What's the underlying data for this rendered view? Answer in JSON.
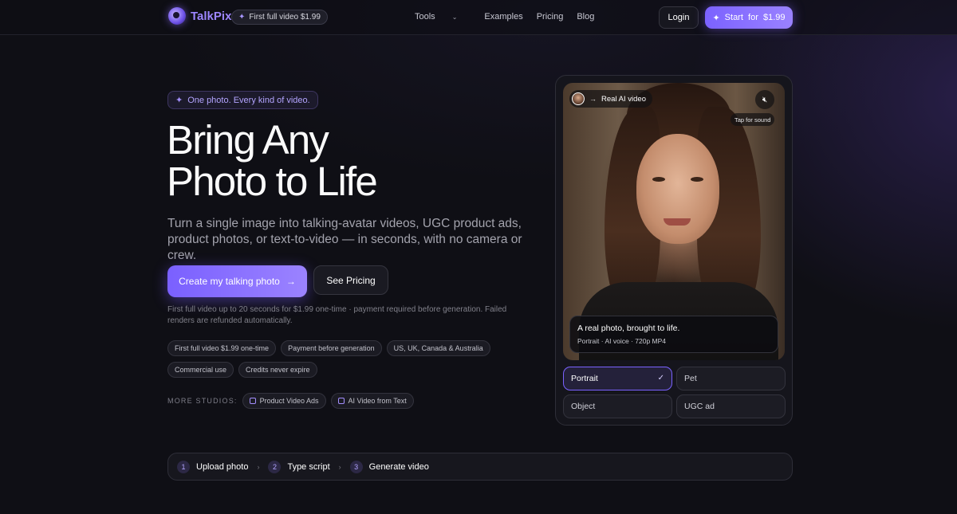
{
  "brand": {
    "name": "TalkPix",
    "accent": "#8b72ff"
  },
  "nav": {
    "badge": "First full video $1.99",
    "links": [
      {
        "label": "Tools",
        "has_dropdown": true
      },
      {
        "label": "Examples"
      },
      {
        "label": "Pricing"
      },
      {
        "label": "Blog"
      }
    ],
    "login": "Login",
    "start": {
      "label": "Start",
      "for": "for",
      "price": "$1.99"
    }
  },
  "hero": {
    "pill": "One photo. Every kind of video.",
    "title_line1": "Bring Any",
    "title_line2": "Photo to Life",
    "subtitle": "Turn a single image into talking-avatar videos, UGC product ads, product photos, or text-to-video — in seconds, with no camera or crew.",
    "cta_primary": "Create my talking photo",
    "cta_secondary": "See Pricing",
    "fine_print": "First full video up to 20 seconds for $1.99 one-time · payment required before generation. Failed renders are refunded automatically.",
    "chips_row1": [
      "First full video $1.99 one-time",
      "Payment before generation",
      "US, UK, Canada & Australia"
    ],
    "chips_row2": [
      "Commercial use",
      "Credits never expire"
    ],
    "more_label": "MORE STUDIOS:",
    "studios": [
      "Product Video Ads",
      "AI Video from Text"
    ]
  },
  "preview": {
    "tag": "Real AI video",
    "tap_for_sound": "Tap for sound",
    "caption_title": "A real photo, brought to life.",
    "caption_meta": "Portrait · AI voice · 720p MP4",
    "options": [
      {
        "label": "Portrait",
        "selected": true
      },
      {
        "label": "Pet",
        "selected": false
      },
      {
        "label": "Object",
        "selected": false
      },
      {
        "label": "UGC ad",
        "selected": false
      }
    ]
  },
  "steps": [
    {
      "num": "1",
      "label": "Upload photo"
    },
    {
      "num": "2",
      "label": "Type script"
    },
    {
      "num": "3",
      "label": "Generate video"
    }
  ]
}
